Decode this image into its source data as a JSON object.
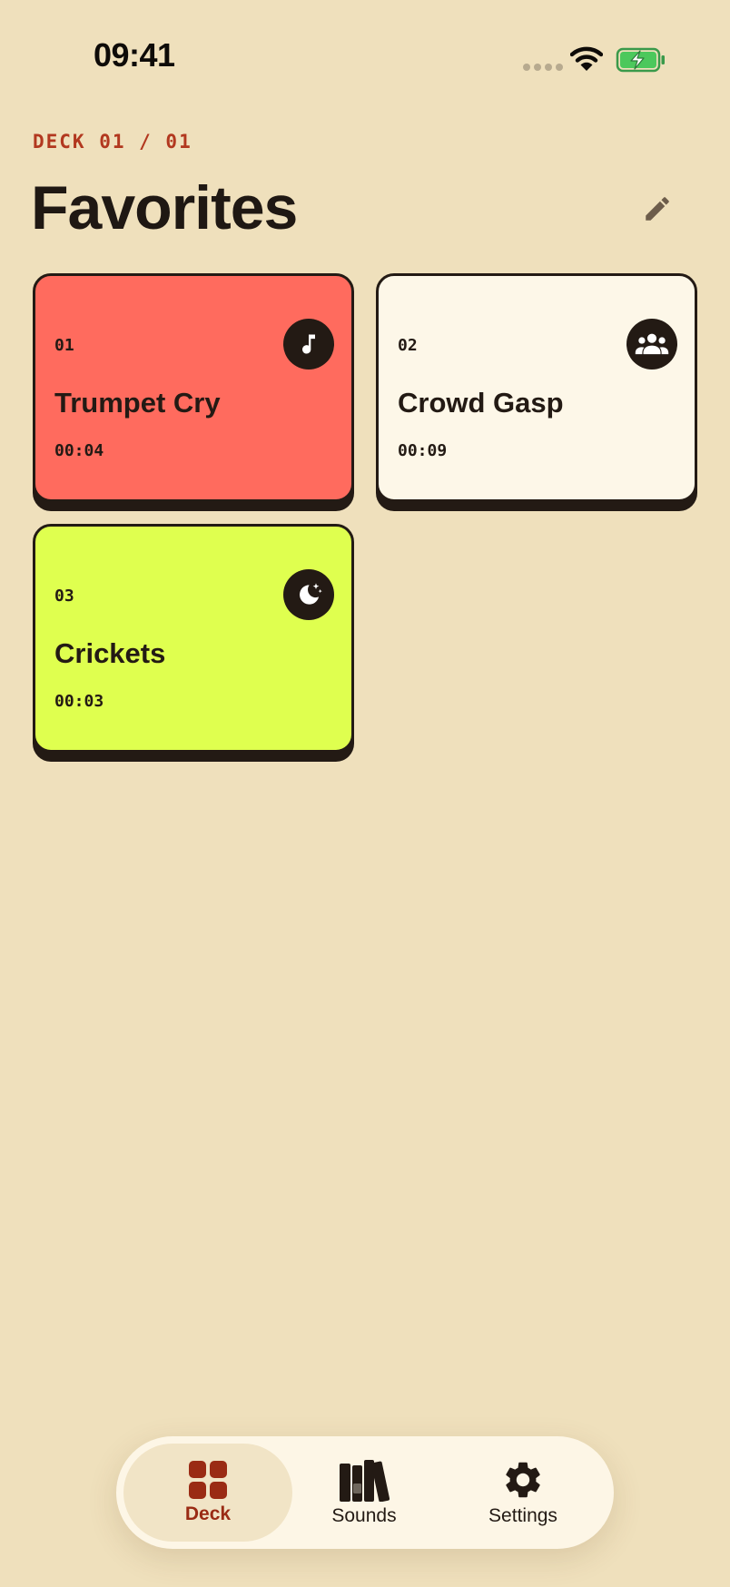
{
  "status_bar": {
    "time": "09:41",
    "icons": [
      "signal-icon",
      "wifi-icon",
      "battery-charging-icon"
    ]
  },
  "header": {
    "deck_indicator": "DECK 01 / 01",
    "title": "Favorites",
    "edit_icon": "pencil-icon"
  },
  "cards": [
    {
      "number": "01",
      "title": "Trumpet Cry",
      "duration": "00:04",
      "icon": "music-note-icon",
      "color": "#ff6b5e"
    },
    {
      "number": "02",
      "title": "Crowd Gasp",
      "duration": "00:09",
      "icon": "group-icon",
      "color": "#fdf7e8"
    },
    {
      "number": "03",
      "title": "Crickets",
      "duration": "00:03",
      "icon": "moon-stars-icon",
      "color": "#dfff4f"
    }
  ],
  "tabs": [
    {
      "label": "Deck",
      "icon": "grid-icon",
      "active": true
    },
    {
      "label": "Sounds",
      "icon": "library-icon",
      "active": false
    },
    {
      "label": "Settings",
      "icon": "gear-icon",
      "active": false
    }
  ],
  "colors": {
    "background": "#efe0bc",
    "accent": "#b2381f",
    "ink": "#231a14"
  }
}
